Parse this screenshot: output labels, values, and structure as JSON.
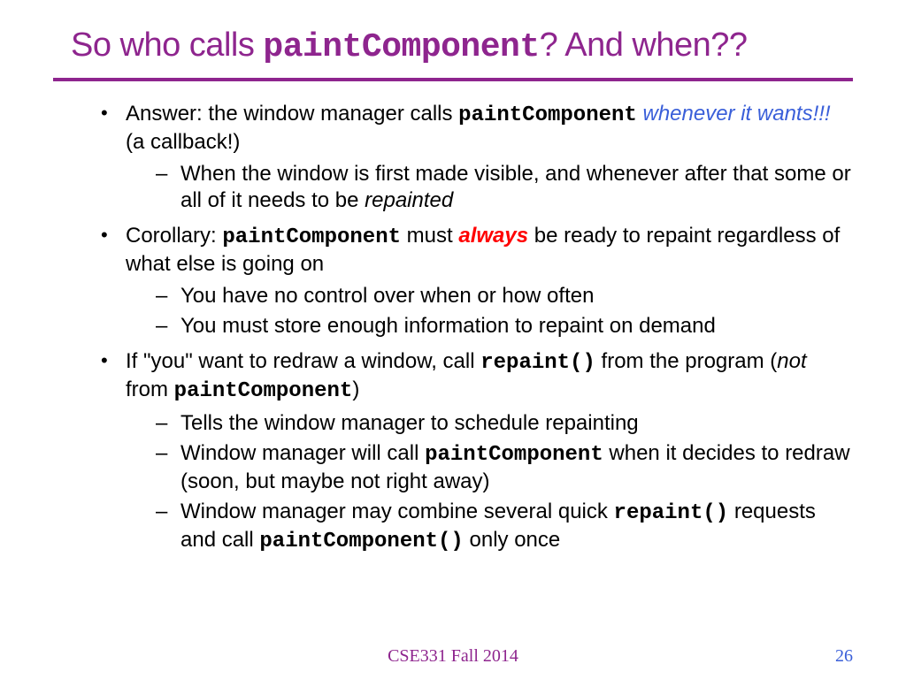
{
  "title": {
    "part1": "So who calls ",
    "code": "paintComponent",
    "part2": "? And when??"
  },
  "bullets": [
    {
      "segments": [
        {
          "text": "Answer: the window manager calls "
        },
        {
          "text": "paintComponent",
          "cls": "code"
        },
        {
          "text": " "
        },
        {
          "text": "whenever it wants!!",
          "cls": "blue-italic"
        },
        {
          "text": "!",
          "cls": "blue-italic"
        },
        {
          "text": "  (a callback!)"
        }
      ],
      "sub": [
        {
          "segments": [
            {
              "text": "When the window is first made visible, and whenever after that some or all of it needs to be "
            },
            {
              "text": "repainted",
              "cls": "plain-italic"
            }
          ]
        }
      ]
    },
    {
      "segments": [
        {
          "text": "Corollary: "
        },
        {
          "text": "paintComponent",
          "cls": "code"
        },
        {
          "text": "  must "
        },
        {
          "text": "always",
          "cls": "red-bold-italic"
        },
        {
          "text": " be ready to repaint regardless of what else is going on"
        }
      ],
      "sub": [
        {
          "segments": [
            {
              "text": "You have no control over when or how often"
            }
          ]
        },
        {
          "segments": [
            {
              "text": "You must store enough information to repaint on demand"
            }
          ]
        }
      ]
    },
    {
      "segments": [
        {
          "text": "If \"you\" want to redraw a window, call "
        },
        {
          "text": "repaint()",
          "cls": "code"
        },
        {
          "text": " from the program ("
        },
        {
          "text": "not",
          "cls": "plain-italic"
        },
        {
          "text": " from "
        },
        {
          "text": "paintComponent",
          "cls": "code"
        },
        {
          "text": ")"
        }
      ],
      "sub": [
        {
          "segments": [
            {
              "text": "Tells the window manager to schedule repainting"
            }
          ]
        },
        {
          "segments": [
            {
              "text": "Window manager will call "
            },
            {
              "text": "paintComponent",
              "cls": "code"
            },
            {
              "text": " when it decides to redraw (soon, but maybe not right away)"
            }
          ]
        },
        {
          "segments": [
            {
              "text": "Window manager may combine several quick "
            },
            {
              "text": "repaint()",
              "cls": "code"
            },
            {
              "text": " requests and call "
            },
            {
              "text": "paintComponent()",
              "cls": "code"
            },
            {
              "text": " only once"
            }
          ]
        }
      ]
    }
  ],
  "footer": "CSE331 Fall 2014",
  "pagenum": "26"
}
